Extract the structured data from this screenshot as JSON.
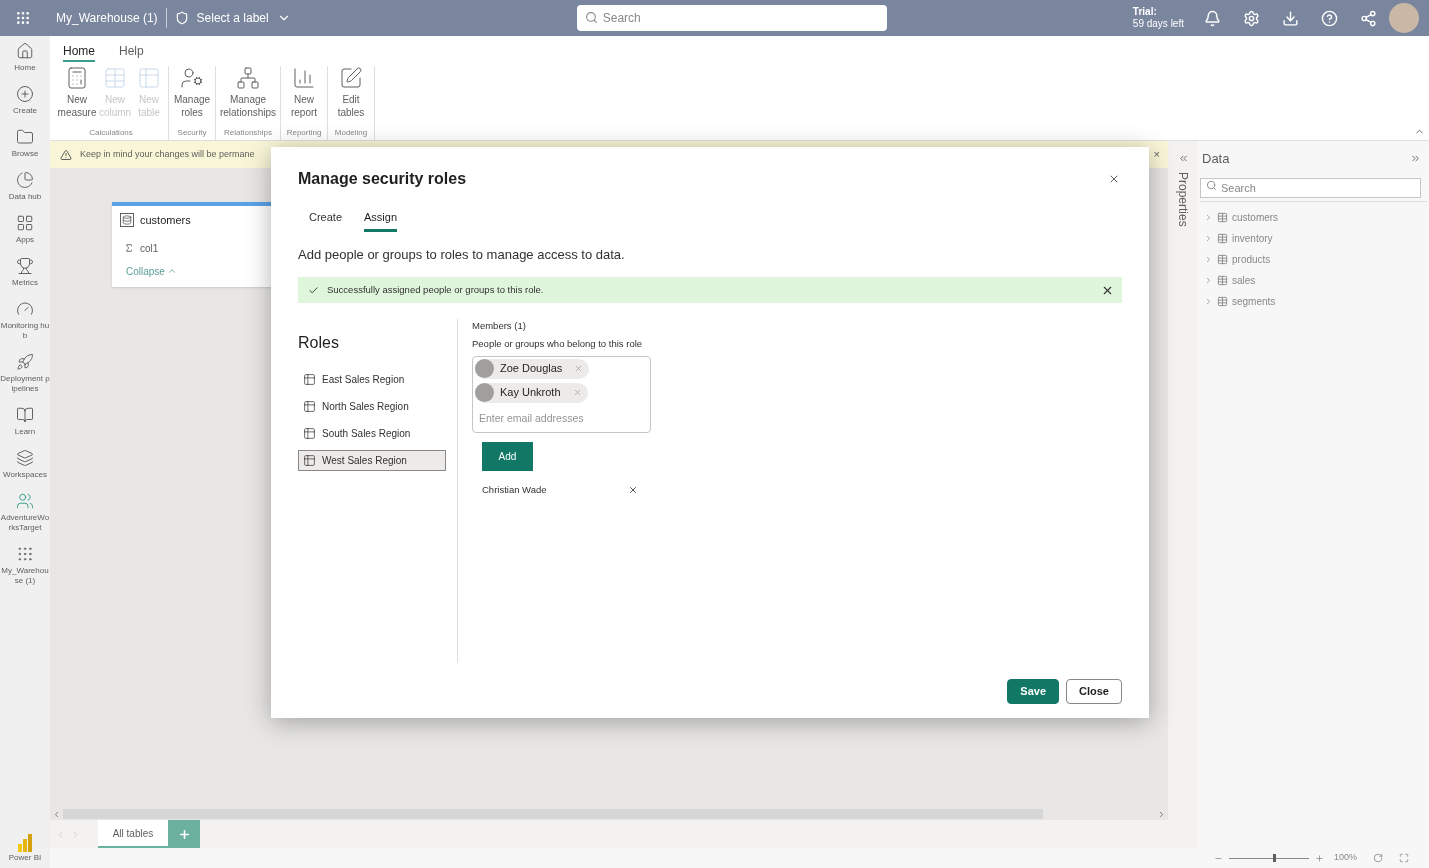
{
  "top_bar": {
    "title": "My_Warehouse (1)",
    "label_picker": "Select a label",
    "search": {
      "placeholder": "Search"
    },
    "trial": [
      "Trial:",
      "59 days left"
    ]
  },
  "nav": {
    "items": [
      {
        "label": "Home"
      },
      {
        "label": "Create"
      },
      {
        "label": "Browse"
      },
      {
        "label": "Data hub"
      },
      {
        "label": "Apps"
      },
      {
        "label": "Metrics"
      },
      {
        "label": "Monitoring hub"
      },
      {
        "label": "Deployment pipelines"
      },
      {
        "label": "Learn"
      },
      {
        "label": "Workspaces"
      },
      {
        "label": "AdventureWorksTarget"
      },
      {
        "label": "My_Warehouse (1)"
      }
    ],
    "footer": "Power BI"
  },
  "ribbon": {
    "tabs": [
      {
        "label": "Home",
        "selected": true
      },
      {
        "label": "Help",
        "selected": false
      }
    ],
    "groups": [
      {
        "label": "Calculations",
        "buttons": [
          {
            "label": "New measure",
            "disabled": false
          },
          {
            "label": "New column",
            "disabled": true
          },
          {
            "label": "New table",
            "disabled": true
          }
        ]
      },
      {
        "label": "Security",
        "buttons": [
          {
            "label": "Manage roles",
            "disabled": false
          }
        ]
      },
      {
        "label": "Relationships",
        "buttons": [
          {
            "label": "Manage relationships",
            "disabled": false
          }
        ]
      },
      {
        "label": "Reporting",
        "buttons": [
          {
            "label": "New report",
            "disabled": false
          }
        ]
      },
      {
        "label": "Modeling",
        "buttons": [
          {
            "label": "Edit tables",
            "disabled": false
          }
        ]
      }
    ]
  },
  "banner": {
    "text": "Keep in mind your changes will be permane",
    "close": "×"
  },
  "canvas": {
    "table_card": {
      "title": "customers",
      "columns": [
        "col1"
      ],
      "collapse": "Collapse"
    }
  },
  "right_pane": {
    "properties_tab": "Properties",
    "title": "Data",
    "search": {
      "placeholder": "Search"
    },
    "tables": [
      "customers",
      "inventory",
      "products",
      "sales",
      "segments"
    ]
  },
  "bottom": {
    "tabs": [
      {
        "label": "All tables",
        "selected": true
      }
    ],
    "zoom": {
      "level": 0.55,
      "reading": "100%"
    }
  },
  "dialog": {
    "title": "Manage security roles",
    "tabs": [
      {
        "label": "Create",
        "selected": false
      },
      {
        "label": "Assign",
        "selected": true
      }
    ],
    "description": "Add people or groups to roles to manage access to data.",
    "success": "Successfully assigned people or groups to this role.",
    "roles_heading": "Roles",
    "roles": [
      {
        "label": "East Sales Region",
        "selected": false
      },
      {
        "label": "North Sales Region",
        "selected": false
      },
      {
        "label": "South Sales Region",
        "selected": false
      },
      {
        "label": "West Sales Region",
        "selected": true
      }
    ],
    "members_label": "Members (1)",
    "members_hint": "People or groups who belong to this role",
    "chips": [
      "Zoe Douglas",
      "Kay Unkroth"
    ],
    "email": {
      "placeholder": "Enter email addresses"
    },
    "add_button": "Add",
    "members": [
      "Christian Wade"
    ],
    "buttons": [
      {
        "label": "Save",
        "kind": "primary"
      },
      {
        "label": "Close",
        "kind": "secondary"
      }
    ]
  }
}
